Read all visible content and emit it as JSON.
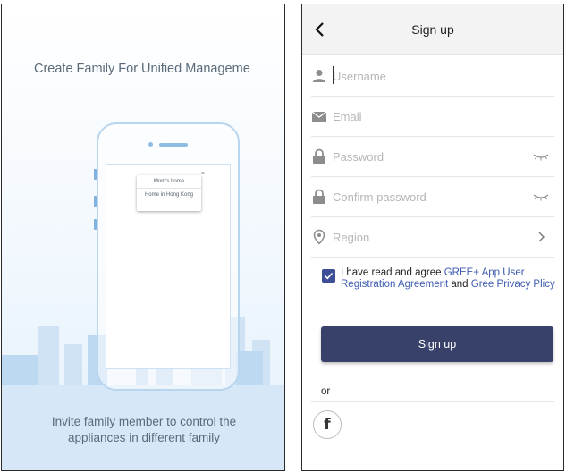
{
  "left_panel": {
    "title": "Create Family For Unified Manageme",
    "popup": {
      "items": [
        "Mom's home",
        "Home in Hong Kong"
      ],
      "close_glyph": "×"
    },
    "footer_lines": [
      "Invite family member to control the",
      "appliances in different family"
    ]
  },
  "signup": {
    "header": {
      "back_icon": "chevron-left-icon",
      "title": "Sign up"
    },
    "fields": {
      "username": {
        "placeholder": "Username",
        "value": "",
        "icon": "user-icon"
      },
      "email": {
        "placeholder": "Email",
        "value": "",
        "icon": "mail-icon"
      },
      "password": {
        "placeholder": "Password",
        "value": "",
        "icon": "lock-icon",
        "toggle_icon": "eye-closed-icon"
      },
      "confirm_password": {
        "placeholder": "Confirm password",
        "value": "",
        "icon": "lock-icon",
        "toggle_icon": "eye-closed-icon"
      },
      "region": {
        "label": "Region",
        "icon": "location-pin-icon",
        "chevron_icon": "chevron-right-icon"
      }
    },
    "agreement": {
      "checked": true,
      "text_1": "I have read and agree ",
      "link_1": "GREE+ App User Registration Agreement",
      "text_2": " and ",
      "link_2": "Gree Privacy Plicy"
    },
    "submit_label": "Sign up",
    "or_label": "or",
    "social": {
      "icon": "facebook-icon",
      "glyph": "f"
    }
  },
  "colors": {
    "primary_button": "#37416a",
    "link": "#3d5bb0",
    "checkbox": "#3d4f96",
    "illustration": "#b9d6ef"
  }
}
